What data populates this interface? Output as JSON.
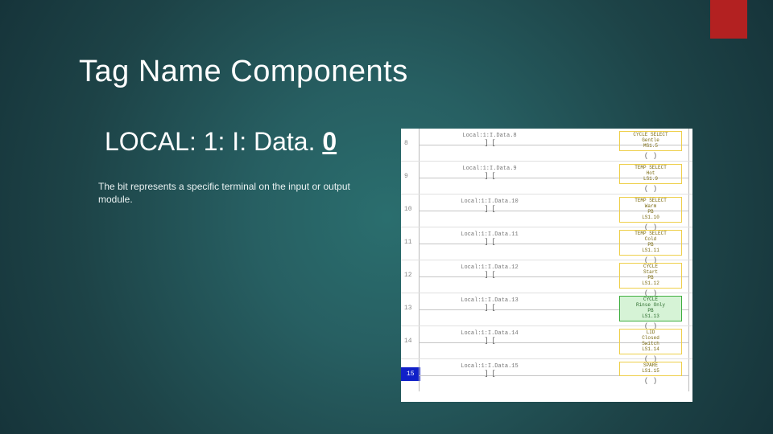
{
  "title": "Tag Name Components",
  "tagline_prefix": "LOCAL: 1: I: Data. ",
  "tagline_bit": "0",
  "description": "The bit represents a specific terminal on the input or output module.",
  "rungs": [
    {
      "num": "8",
      "contact": "Local:1:I.Data.8",
      "coil": {
        "l1": "CYCLE SELECT",
        "l2": "Gentle",
        "l3": "MS1.5"
      },
      "green": false
    },
    {
      "num": "9",
      "contact": "Local:1:I.Data.9",
      "coil": {
        "l1": "TEMP SELECT",
        "l2": "Hot",
        "l3": "LS1.9"
      },
      "green": false
    },
    {
      "num": "10",
      "contact": "Local:1:I.Data.10",
      "coil": {
        "l1": "TEMP SELECT",
        "l2": "Warm",
        "l3": "PB",
        "l4": "LS1.10"
      },
      "green": false
    },
    {
      "num": "11",
      "contact": "Local:1:I.Data.11",
      "coil": {
        "l1": "TEMP SELECT",
        "l2": "Cold",
        "l3": "PB",
        "l4": "LS1.11"
      },
      "green": false
    },
    {
      "num": "12",
      "contact": "Local:1:I.Data.12",
      "coil": {
        "l1": "CYCLE",
        "l2": "Start",
        "l3": "PB",
        "l4": "LS1.12"
      },
      "green": false
    },
    {
      "num": "13",
      "contact": "Local:1:I.Data.13",
      "coil": {
        "l1": "CYCLE",
        "l2": "Rinse Only",
        "l3": "PB",
        "l4": "LS1.13"
      },
      "green": true
    },
    {
      "num": "14",
      "contact": "Local:1:I.Data.14",
      "coil": {
        "l1": "LID",
        "l2": "Closed",
        "l3": "Switch",
        "l4": "LS1.14"
      },
      "green": false
    },
    {
      "num": "15",
      "contact": "Local:1:I.Data.15",
      "coil": {
        "l1": "SPARE",
        "l2": "",
        "l3": "LS1.15"
      },
      "green": false
    }
  ]
}
